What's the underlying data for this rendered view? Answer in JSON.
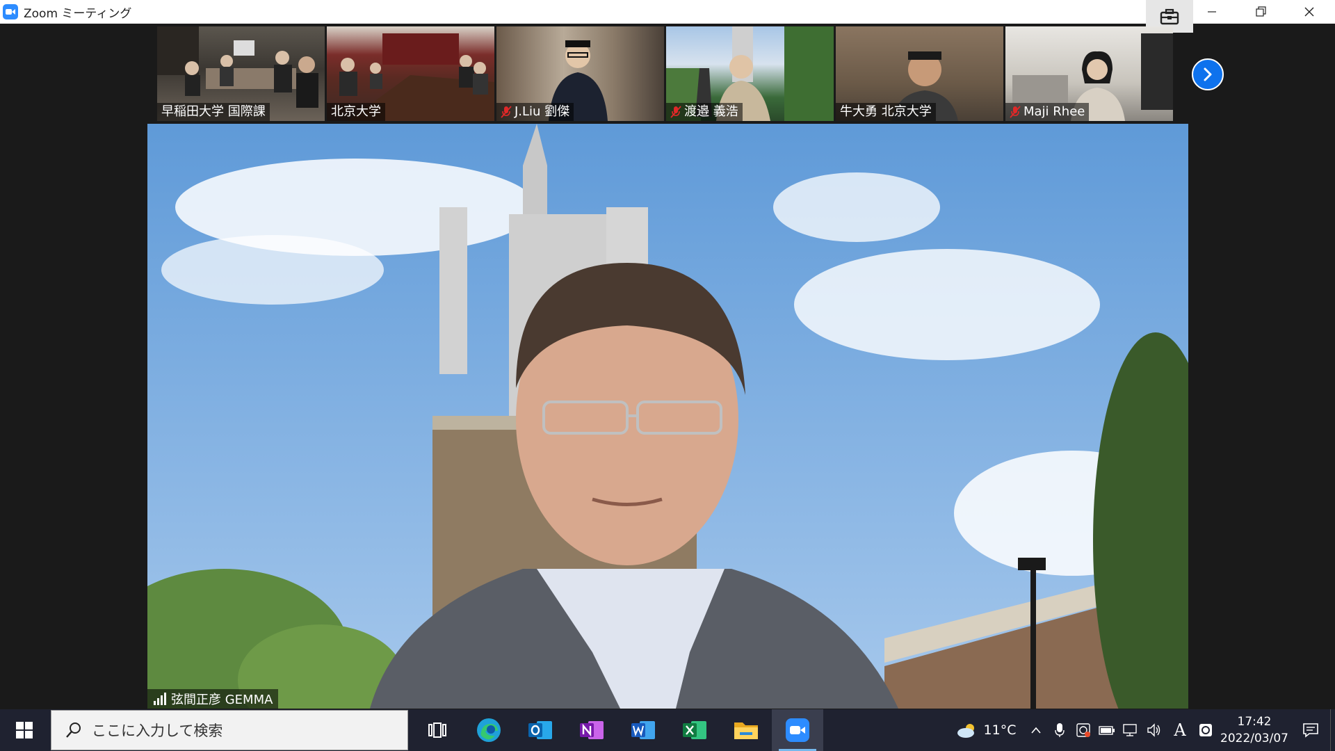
{
  "window": {
    "title": "Zoom ミーティング"
  },
  "participants": [
    {
      "name": "早稲田大学 国際課",
      "muted": false
    },
    {
      "name": "北京大学",
      "muted": false
    },
    {
      "name": "J.Liu 劉傑",
      "muted": true
    },
    {
      "name": "渡邉 義浩",
      "muted": true
    },
    {
      "name": "牛大勇 北京大学",
      "muted": false
    },
    {
      "name": "Maji Rhee",
      "muted": true
    }
  ],
  "active_speaker": {
    "name": "弦間正彦  GEMMA"
  },
  "taskbar": {
    "search_placeholder": "ここに入力して検索",
    "apps": [
      "task-view",
      "edge",
      "outlook",
      "onenote",
      "word",
      "excel",
      "file-explorer",
      "zoom"
    ],
    "weather": "11°C",
    "ime": "A",
    "time": "17:42",
    "date": "2022/03/07"
  },
  "colors": {
    "zoom_blue": "#2d8cff",
    "next_button": "#0e72ed",
    "muted_red": "#e02828",
    "taskbar": "#1f2230"
  }
}
